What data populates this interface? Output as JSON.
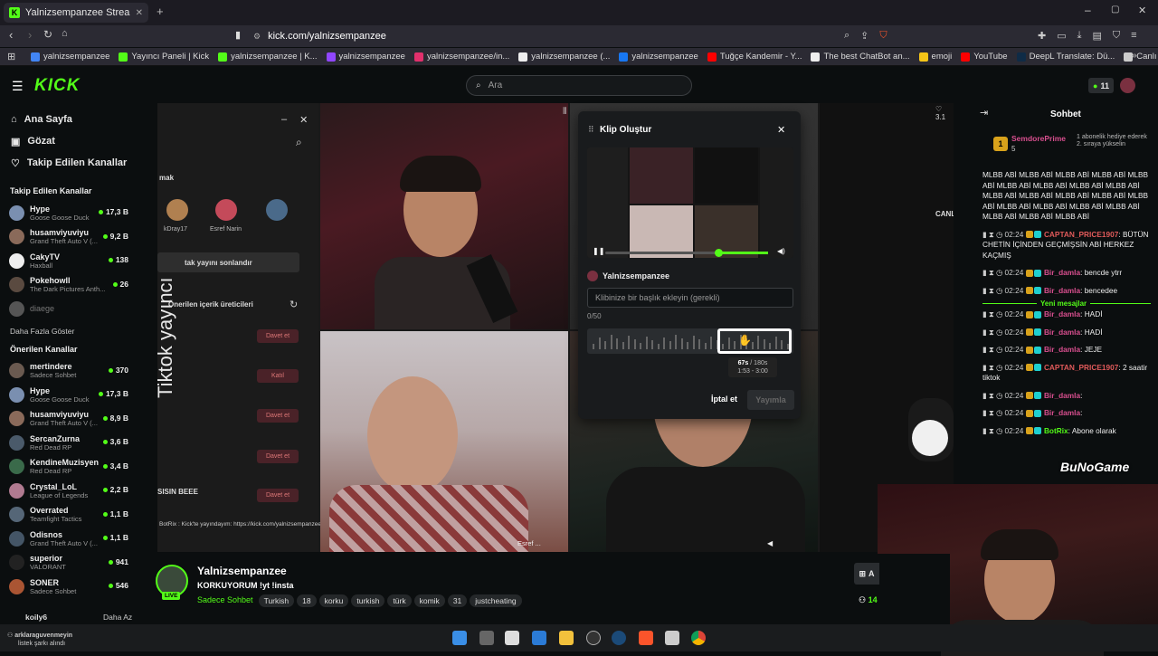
{
  "browser": {
    "tab_title": "Yalnizsempanzee Stream - W",
    "url": "kick.com/yalnizsempanzee",
    "bookmarks": [
      "yalnizsempanzee",
      "Yayıncı Paneli | Kick",
      "yalnizsempanzee | K...",
      "yalnizsempanzee",
      "yalnizsempanzee/in...",
      "yalnizsempanzee (...",
      "yalnizsempanzee",
      "Tuğçe Kandemir - Y...",
      "The best ChatBot an...",
      "emoji",
      "YouTube",
      "DeepL Translate: Dü...",
      "Canlı Yayın İçerikleri"
    ],
    "bookmark_colors": [
      "#4285f4",
      "#53fc18",
      "#53fc18",
      "#9146ff",
      "#e1306c",
      "#eee",
      "#1877f2",
      "#ff0000",
      "#eee",
      "#f5c518",
      "#ff0000",
      "#0f2b46",
      "#ccc"
    ]
  },
  "header": {
    "logo": "KICK",
    "search_placeholder": "Ara",
    "notif_count": "11"
  },
  "sidebar": {
    "nav": [
      {
        "label": "Ana Sayfa",
        "icon": "home-icon"
      },
      {
        "label": "Gözat",
        "icon": "browse-icon"
      },
      {
        "label": "Takip Edilen Kanallar",
        "icon": "heart-icon"
      }
    ],
    "followed_heading": "Takip Edilen Kanallar",
    "followed": [
      {
        "name": "Hype",
        "cat": "Goose Goose Duck",
        "viewers": "17,3 B",
        "color": "#7a8fb0"
      },
      {
        "name": "husamviyuviyu",
        "cat": "Grand Theft Auto V (...",
        "viewers": "9,2 B",
        "color": "#8a6a5a"
      },
      {
        "name": "CakyTV",
        "cat": "Haxball",
        "viewers": "138",
        "color": "#eeeeee"
      },
      {
        "name": "Pokehowll",
        "cat": "The Dark Pictures Anth...",
        "viewers": "26",
        "color": "#5a4a40"
      },
      {
        "name": "diaege",
        "cat": "",
        "viewers": "",
        "color": "#555555"
      }
    ],
    "show_more": "Daha Fazla Göster",
    "recommended_heading": "Önerilen Kanallar",
    "recommended": [
      {
        "name": "mertindere",
        "cat": "Sadece Sohbet",
        "viewers": "370",
        "color": "#6a5a50"
      },
      {
        "name": "Hype",
        "cat": "Goose Goose Duck",
        "viewers": "17,3 B",
        "color": "#7a8fb0"
      },
      {
        "name": "husamviyuviyu",
        "cat": "Grand Theft Auto V (...",
        "viewers": "8,9 B",
        "color": "#8a6a5a"
      },
      {
        "name": "SercanZurna",
        "cat": "Red Dead RP",
        "viewers": "3,6 B",
        "color": "#4a5a6a"
      },
      {
        "name": "KendineMuzisyen",
        "cat": "Red Dead RP",
        "viewers": "3,4 B",
        "color": "#3a6a4a"
      },
      {
        "name": "Crystal_LoL",
        "cat": "League of Legends",
        "viewers": "2,2 B",
        "color": "#b07a90"
      },
      {
        "name": "Overrated",
        "cat": "Teamfight Tactics",
        "viewers": "1,1 B",
        "color": "#556677"
      },
      {
        "name": "Odisnos",
        "cat": "Grand Theft Auto V (...",
        "viewers": "1,1 B",
        "color": "#445566"
      },
      {
        "name": "superior",
        "cat": "VALORANT",
        "viewers": "941",
        "color": "#222222"
      },
      {
        "name": "SONER",
        "cat": "Sadece Sohbet",
        "viewers": "546",
        "color": "#aa5533"
      }
    ],
    "bottom_user": "koilу6",
    "less": "Daha Az",
    "corner_user": "arklaraguvenmeyin",
    "corner_sub": "listek şarkı alındı"
  },
  "stream_panel": {
    "vertical_text": "Tiktok yayıncı",
    "item_mak": "mak",
    "users": [
      "kDray17",
      "Esref Narin"
    ],
    "end_button": "tak yayını sonlandır",
    "creators_label": "Önerilen içerik üreticileri",
    "invite": "Davet et",
    "join": "Katıl",
    "guest": "SISIN BEEE",
    "bot_line": "BotRix : Kick'te yayındayım: https://kick.com/yalnizsempanzee",
    "overlay_name": "Esref ...",
    "side_text": "CANL",
    "like_count": "3.1"
  },
  "clip_modal": {
    "title": "Klip Oluştur",
    "channel": "Yalnizsempanzee",
    "input_placeholder": "Klibinize bir başlık ekleyin (gerekli)",
    "counter": "0/50",
    "duration": "67s",
    "duration_max": "/ 180s",
    "range": "1:53 - 3:00",
    "cancel": "İptal et",
    "publish": "Yayımla",
    "thumb_text": "Tiktok yayıncı"
  },
  "chat": {
    "title": "Sohbet",
    "pinned_user": "SemdorePrime",
    "pinned_count": "5",
    "pinned_text": "1 abonelik hediye ederek 2. sıraya yükselin",
    "spam": "MLBB ABİ MLBB ABİ MLBB ABİ MLBB ABİ MLBB ABİ MLBB ABİ MLBB ABİ MLBB ABİ MLBB ABİ MLBB ABİ MLBB ABİ MLBB ABİ MLBB ABİ MLBB ABİ MLBB ABİ MLBB ABİ MLBB ABİ MLBB ABİ MLBB ABİ MLBB ABİ MLBB ABİ",
    "new_messages": "Yeni mesajlar",
    "messages": [
      {
        "time": "02:24",
        "user": "CAPTAN_PRICE1907",
        "color": "#e05a5a",
        "text": "BÜTÜN CHETİN İÇİNDEN GEÇMİŞSİN ABİ HERKEZ KAÇMIŞ"
      },
      {
        "time": "02:24",
        "user": "Bir_damla",
        "color": "#d94f8f",
        "text": "bencde ytrr"
      },
      {
        "time": "02:24",
        "user": "Bir_damla",
        "color": "#d94f8f",
        "text": "bencedee"
      },
      {
        "time": "02:24",
        "user": "Bir_damla",
        "color": "#d94f8f",
        "text": "HADİ"
      },
      {
        "time": "02:24",
        "user": "Bir_damla",
        "color": "#d94f8f",
        "text": "HADİ"
      },
      {
        "time": "02:24",
        "user": "Bir_damla",
        "color": "#d94f8f",
        "text": "JEJE"
      },
      {
        "time": "02:24",
        "user": "CAPTAN_PRICE1907",
        "color": "#e05a5a",
        "text": "2 saatir tiktok"
      },
      {
        "time": "02:24",
        "user": "Bir_damla",
        "color": "#d94f8f",
        "text": ""
      },
      {
        "time": "02:24",
        "user": "Bir_damla",
        "color": "#d94f8f",
        "text": ""
      },
      {
        "time": "02:24",
        "user": "BotRix",
        "color": "#53fc18",
        "text": "Abone olarak"
      }
    ]
  },
  "channel_info": {
    "name": "Yalnizsempanzee",
    "live": "LIVE",
    "title": "KORKUYORUM !yt !insta",
    "category": "Sadece Sohbet",
    "tags": [
      "Turkish",
      "18",
      "korku",
      "turkish",
      "türk",
      "komik",
      "31",
      "justcheating"
    ],
    "viewer_partial": "14",
    "button_partial": "A"
  },
  "overlay": {
    "brand": "BuNoGame"
  }
}
